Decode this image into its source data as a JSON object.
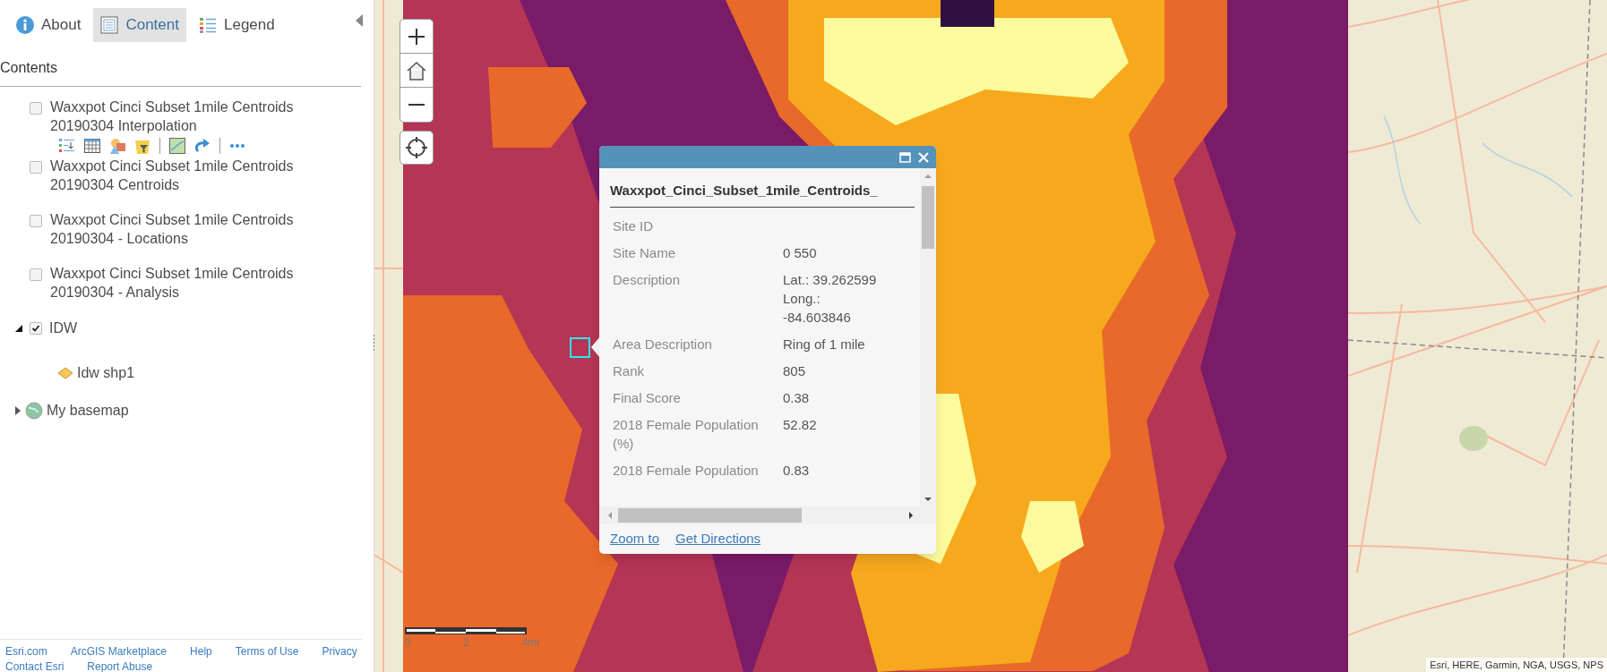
{
  "panel": {
    "tabs": [
      {
        "label": "About",
        "selected": false
      },
      {
        "label": "Content",
        "selected": true
      },
      {
        "label": "Legend",
        "selected": false
      }
    ],
    "heading": "Contents",
    "layers": [
      {
        "kind": "layer",
        "name": "Waxxpot Cinci Subset 1mile Centroids 20190304 Interpolation",
        "checked": false,
        "selected": true
      },
      {
        "kind": "layer",
        "name": "Waxxpot Cinci Subset 1mile Centroids 20190304 Centroids",
        "checked": false,
        "selected": false
      },
      {
        "kind": "layer",
        "name": "Waxxpot Cinci Subset 1mile Centroids 20190304 - Locations",
        "checked": false,
        "selected": false
      },
      {
        "kind": "layer",
        "name": "Waxxpot Cinci Subset 1mile Centroids 20190304 - Analysis",
        "checked": false,
        "selected": false
      },
      {
        "kind": "group",
        "name": "IDW",
        "checked": true,
        "expanded": true,
        "children": [
          {
            "name": "Idw shp1"
          }
        ]
      },
      {
        "kind": "basemap",
        "name": "My basemap",
        "expanded": false
      }
    ],
    "footer_links": [
      "Esri.com",
      "ArcGIS Marketplace",
      "Help",
      "Terms of Use",
      "Privacy",
      "Contact Esri",
      "Report Abuse"
    ]
  },
  "map": {
    "scale_labels": [
      "0",
      "2",
      "4mi"
    ],
    "attribution": "Esri, HERE, Garmin, NGA, USGS, NPS",
    "popup": {
      "title": "Waxxpot_Cinci_Subset_1mile_Centroids_",
      "fields": [
        {
          "label": "Site ID"
        },
        {
          "label": "Site Name",
          "value": "0 550"
        },
        {
          "label": "Description",
          "value": "Lat.: 39.262599 Long.: -84.603846"
        },
        {
          "label": "Area Description",
          "value": "Ring of 1 mile"
        },
        {
          "label": "Rank",
          "value": "805"
        },
        {
          "label": "Final Score",
          "value": "0.38"
        },
        {
          "label": "2018 Female Population (%)",
          "value": "52.82"
        },
        {
          "label": "2018 Female Population",
          "value": "0.83"
        }
      ],
      "actions": [
        "Zoom to",
        "Get Directions"
      ]
    }
  }
}
